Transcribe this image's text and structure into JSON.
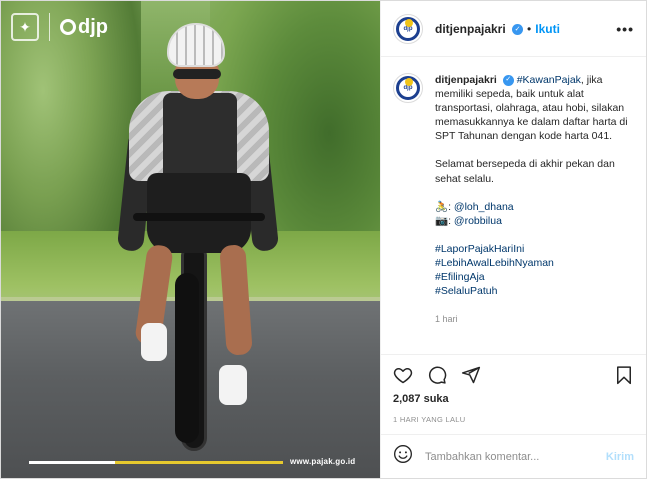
{
  "photo": {
    "brand_name": "djp",
    "website": "www.pajak.go.id",
    "progress": 0.34
  },
  "header": {
    "username": "ditjenpajakri",
    "dot": "•",
    "follow_label": "Ikuti",
    "more_label": "•••"
  },
  "caption": {
    "username": "ditjenpajakri",
    "hashtag_main": "#KawanPajak",
    "text": ", jika memiliki sepeda, baik untuk alat transportasi, olahraga, atau hobi, silakan memasukkannya ke dalam daftar harta di SPT Tahunan dengan kode harta 041.",
    "closing": "Selamat bersepeda di akhir pekan dan sehat selalu.",
    "credit_1_prefix": "🚴: ",
    "credit_1": "@loh_dhana",
    "credit_2_prefix": "📷: ",
    "credit_2": "@robbilua",
    "hashtags": [
      "#LaporPajakHariIni",
      "#LebihAwalLebihNyaman",
      "#EfilingAja",
      "#SelaluPatuh"
    ],
    "time": "1 hari"
  },
  "footer": {
    "likes": "2,087 suka",
    "posted": "1 HARI YANG LALU",
    "comment_placeholder": "Tambahkan komentar...",
    "post_label": "Kirim"
  },
  "colors": {
    "accent": "#0095f6",
    "link": "#00376b",
    "brand_blue": "#1c3f8f",
    "brand_yellow": "#f0c419"
  },
  "icons": [
    "heart-icon",
    "comment-icon",
    "share-icon",
    "bookmark-icon",
    "emoji-icon",
    "verified-icon",
    "more-icon"
  ]
}
